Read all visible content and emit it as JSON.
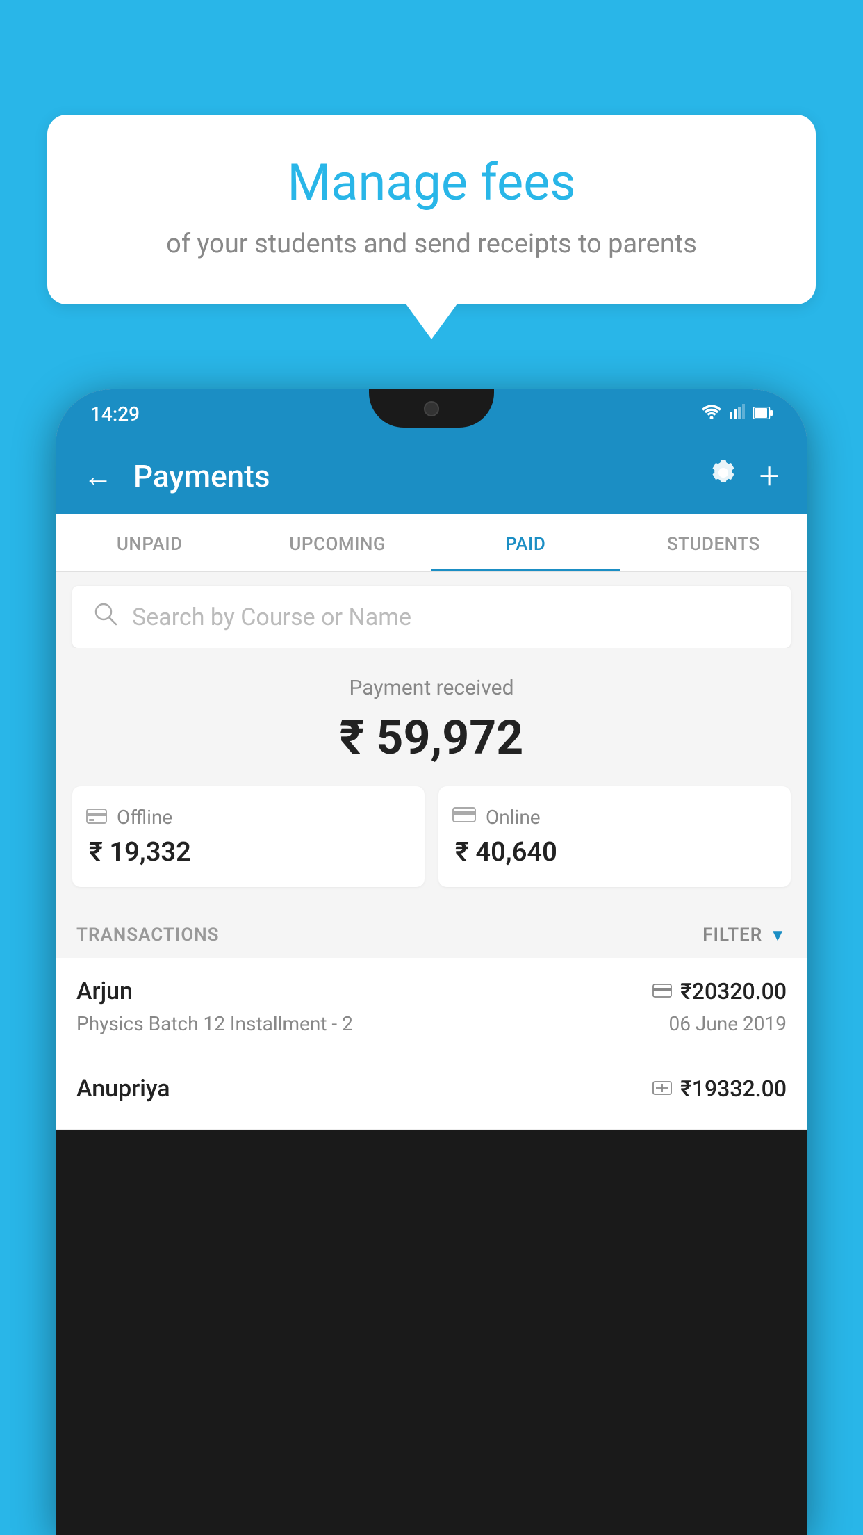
{
  "background_color": "#29b6e8",
  "speech_bubble": {
    "title": "Manage fees",
    "subtitle": "of your students and send receipts to parents"
  },
  "phone": {
    "status_bar": {
      "time": "14:29",
      "wifi": "▾",
      "signal": "▲",
      "battery": "▮"
    },
    "app_bar": {
      "back_label": "←",
      "title": "Payments",
      "gear_label": "⚙",
      "plus_label": "+"
    },
    "tabs": [
      {
        "label": "UNPAID",
        "active": false
      },
      {
        "label": "UPCOMING",
        "active": false
      },
      {
        "label": "PAID",
        "active": true
      },
      {
        "label": "STUDENTS",
        "active": false
      }
    ],
    "search": {
      "placeholder": "Search by Course or Name"
    },
    "payment_summary": {
      "label": "Payment received",
      "amount": "₹ 59,972",
      "offline_label": "Offline",
      "offline_amount": "₹ 19,332",
      "online_label": "Online",
      "online_amount": "₹ 40,640"
    },
    "transactions": {
      "header_label": "TRANSACTIONS",
      "filter_label": "FILTER",
      "items": [
        {
          "name": "Arjun",
          "payment_type": "online",
          "amount": "₹20320.00",
          "course": "Physics Batch 12 Installment - 2",
          "date": "06 June 2019"
        },
        {
          "name": "Anupriya",
          "payment_type": "offline",
          "amount": "₹19332.00",
          "course": "",
          "date": ""
        }
      ]
    }
  }
}
